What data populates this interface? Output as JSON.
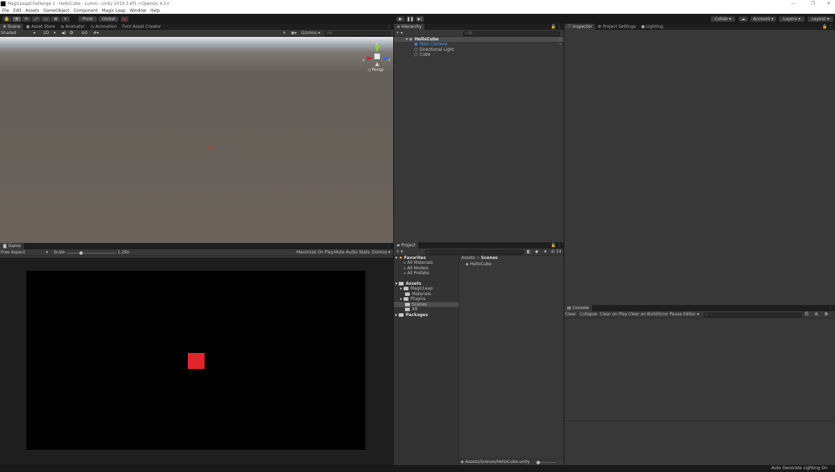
{
  "window": {
    "title": "MagicLeapChallenge-1 - HelloCube - Lumin - Unity 2019.3.6f1 <OpenGL 4.5>",
    "minimize": "—",
    "maximize": "❐",
    "close": "✕"
  },
  "menu": [
    "File",
    "Edit",
    "Assets",
    "GameObject",
    "Component",
    "Magic Leap",
    "Window",
    "Help"
  ],
  "toolbar": {
    "tools": [
      "hand-tool",
      "move-tool",
      "rotate-tool",
      "scale-tool",
      "rect-tool",
      "transform-tool",
      "custom-tool"
    ],
    "pivot": "Pivot",
    "global": "Global",
    "collab": "Collab ▾",
    "account": "Account ▾",
    "layers": "Layers ▾",
    "layout": "Layout ▾",
    "play": "▶",
    "pause": "❚❚",
    "step": "▶|"
  },
  "scene_panel": {
    "tabs": [
      "Scene",
      "Asset Store",
      "Animator",
      "Animation",
      "Font Asset Creator"
    ],
    "shading": "Shaded",
    "twod": "2D",
    "gizmos": "Gizmos ▾",
    "search_placeholder": "All",
    "persp": "◁ Persp",
    "gizmo_labels": {
      "y": "y",
      "x": "x",
      "z": "z"
    }
  },
  "game_panel": {
    "tab": "Game",
    "aspect": "Free Aspect",
    "scale_label": "Scale",
    "scale_value": "1.29x",
    "scale_fraction": 0.28,
    "maximize": "Maximize On Play",
    "mute": "Mute Audio",
    "stats": "Stats",
    "gizmos": "Gizmos ▾"
  },
  "hierarchy": {
    "tab": "Hierarchy",
    "search_placeholder": "All",
    "scene": "HelloCube",
    "items": [
      "Main Camera",
      "Directional Light",
      "Cube"
    ]
  },
  "project": {
    "tab": "Project",
    "favorites": "Favorites",
    "favorite_items": [
      "All Materials",
      "All Models",
      "All Prefabs"
    ],
    "assets": "Assets",
    "asset_folders": [
      "MagicLeap",
      "Materials",
      "Plugins",
      "Scenes",
      "XR"
    ],
    "packages": "Packages",
    "breadcrumb_root": "Assets",
    "breadcrumb_current": "Scenes",
    "files": [
      "HelloCube"
    ],
    "path": "Assets/Scenes/HelloCube.unity",
    "hidden_count": "14"
  },
  "inspector": {
    "tabs": [
      "Inspector",
      "Project Settings",
      "Lighting"
    ]
  },
  "console": {
    "tab": "Console",
    "buttons": [
      "Clear",
      "Collapse",
      "Clear on Play",
      "Clear on Build",
      "Error Pause",
      "Editor ▾"
    ],
    "counts": [
      "0",
      "0",
      "0"
    ]
  },
  "status": {
    "right": "Auto Generate Lighting On"
  },
  "colors": {
    "accent": "#4a9eff",
    "cube": "#e0262a",
    "panel": "#383838",
    "background": "#191919"
  }
}
